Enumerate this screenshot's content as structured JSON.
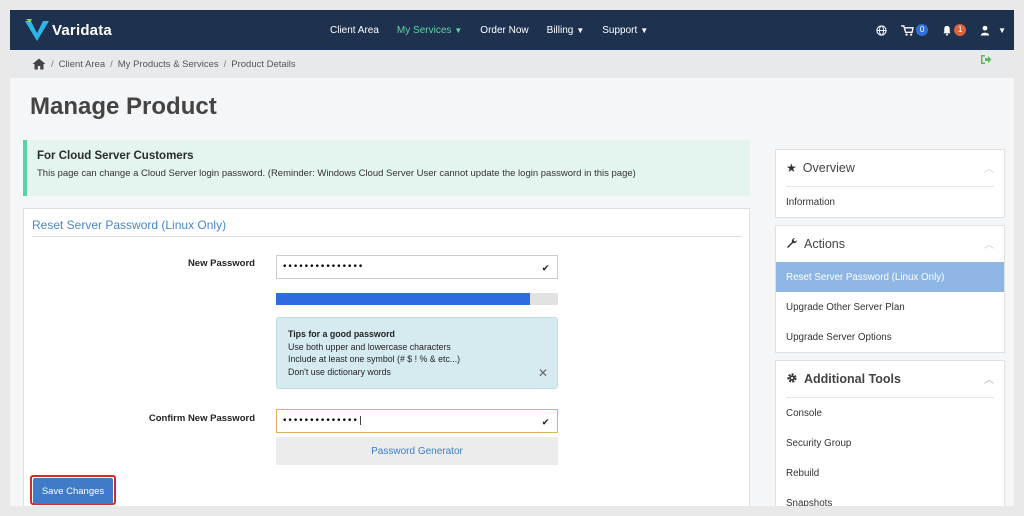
{
  "brand": {
    "name": "Varidata"
  },
  "nav": {
    "items": [
      {
        "label": "Client Area"
      },
      {
        "label": "My Services"
      },
      {
        "label": "Order Now"
      },
      {
        "label": "Billing"
      },
      {
        "label": "Support"
      }
    ],
    "cart_count": "0",
    "notification_count": "1"
  },
  "breadcrumb": {
    "items": [
      "Client Area",
      "My Products & Services",
      "Product Details"
    ]
  },
  "page": {
    "title": "Manage Product"
  },
  "alert": {
    "title": "For Cloud Server Customers",
    "text": "This page can change a Cloud Server login password. (Reminder: Windows Cloud Server User cannot update the login password in this page)"
  },
  "form": {
    "title": "Reset Server Password (Linux Only)",
    "new_password_label": "New Password",
    "new_password_value": "•••••••••••••••",
    "strength_fraction": 0.9,
    "tips": {
      "title": "Tips for a good password",
      "lines": [
        "Use both upper and lowercase characters",
        "Include at least one symbol (# $ ! % & etc...)",
        "Don't use dictionary words"
      ]
    },
    "confirm_label": "Confirm New Password",
    "confirm_value": "••••••••••••••|",
    "generator_label": "Password Generator",
    "save_label": "Save Changes"
  },
  "sidebar": {
    "overview": {
      "title": "Overview",
      "items": [
        "Information"
      ]
    },
    "actions": {
      "title": "Actions",
      "items": [
        "Reset Server Password (Linux Only)",
        "Upgrade Other Server Plan",
        "Upgrade Server Options"
      ]
    },
    "tools": {
      "title": "Additional Tools",
      "items": [
        "Console",
        "Security Group",
        "Rebuild",
        "Snapshots"
      ]
    }
  },
  "colors": {
    "accent": "#5fd3a1",
    "primary": "#3f7bc6",
    "nav_bg": "#1e3250"
  }
}
